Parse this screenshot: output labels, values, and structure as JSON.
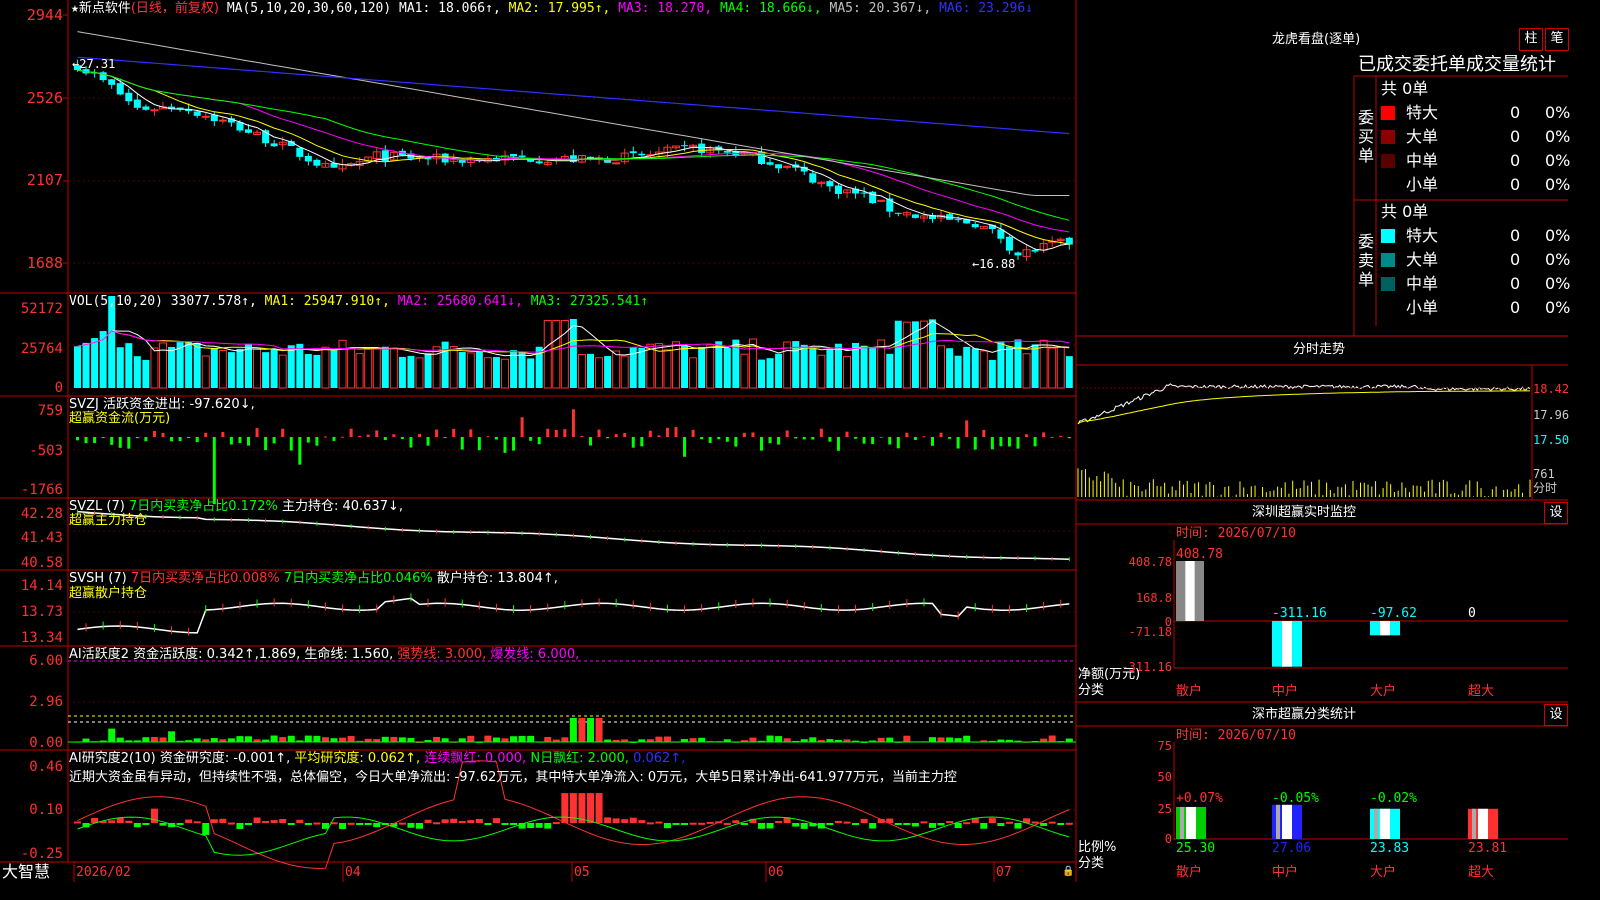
{
  "colors": {
    "up": "#ff3232",
    "down": "#00ffff",
    "ma1": "#ffffff",
    "ma2": "#ffff00",
    "ma3": "#ff00ff",
    "ma4": "#00ff00",
    "ma5": "#c0c0c0",
    "ma6": "#3030ff",
    "grid": "#c00000",
    "green": "#00ff00",
    "yellow": "#ffff00",
    "magenta": "#ff00ff"
  },
  "price_panel": {
    "star_icon": "star-icon",
    "stock_name": "新点软件",
    "period": "(日线，前复权)",
    "ma_label": "MA(5,10,20,30,60,120)",
    "ma1": "MA1: 18.066↑,",
    "ma2": "MA2: 17.995↑,",
    "ma3": "MA3: 18.270,",
    "ma4": "MA4: 18.666↓,",
    "ma5": "MA5: 20.367↓,",
    "ma6": "MA6: 23.296↓",
    "ticks": [
      "2944",
      "2526",
      "2107",
      "1688"
    ],
    "high_label": "←27.31",
    "low_label": "←16.88"
  },
  "vol_panel": {
    "label": "VOL(5,10,20)",
    "value": "33077.578↑,",
    "ma1": "MA1: 25947.910↑,",
    "ma2": "MA2: 25680.641↓,",
    "ma3": "MA3: 27325.541↑",
    "ticks": [
      "52172",
      "25764",
      "0"
    ]
  },
  "svzj_panel": {
    "label": "SVZJ  活跃资金进出: -97.620↓,",
    "sub": "超赢资金流(万元)",
    "ticks": [
      "759",
      "-503",
      "-1766"
    ]
  },
  "svzl_panel": {
    "label": "SVZL (7)",
    "g1": "7日内买卖净占比0.172%",
    "g2": "主力持仓: 40.637↓,",
    "sub": "超赢主力持仓",
    "ticks": [
      "42.28",
      "41.43",
      "40.58"
    ]
  },
  "svsh_panel": {
    "label": "SVSH (7)",
    "r1": "7日内买卖净占比0.008%",
    "g1": "7日内买卖净占比0.046%",
    "w1": "散户持仓: 13.804↑,",
    "sub": "超赢散户持仓",
    "ticks": [
      "14.14",
      "13.73",
      "13.34"
    ]
  },
  "ai_active": {
    "label": "AI活跃度2",
    "w1": "资金活跃度: 0.342↑,1.869,",
    "w2": "生命线: 1.560,",
    "r1": "强势线: 3.000,",
    "m1": "爆发线: 6.000,",
    "ticks": [
      "6.00",
      "2.96",
      "0.00"
    ]
  },
  "ai_research": {
    "label": "AI研究度2(10)",
    "w1": "资金研究度: -0.001↑,",
    "y1": "平均研究度: 0.062↑,",
    "m1": "连续飘红: 0.000,",
    "g1": "N日飘红: 2.000,",
    "b1": "0.062↑,",
    "comment": "近期大资金虽有异动，但持续性不强，总体偏空，今日大单净流出: -97.62万元，其中特大单净流入: 0万元，大单5日累计净出-641.977万元，当前主力控",
    "ticks": [
      "0.46",
      "0.10",
      "-0.25"
    ]
  },
  "date_axis": {
    "brand": "大智慧",
    "dates": [
      "2026/02",
      "04",
      "05",
      "06",
      "07"
    ]
  },
  "right": {
    "lhkp_title": "龙虎看盘(逐单)",
    "btn_zhu": "柱",
    "btn_bi": "笔",
    "stats_title": "已成交委托单成交量统计",
    "buy_label": "委买单",
    "sell_label": "委卖单",
    "buy_total": "共 0单",
    "sell_total": "共 0单",
    "buy_rows": [
      {
        "name": "特大",
        "v": "0",
        "p": "0%"
      },
      {
        "name": "大单",
        "v": "0",
        "p": "0%"
      },
      {
        "name": "中单",
        "v": "0",
        "p": "0%"
      },
      {
        "name": "小单",
        "v": "0",
        "p": "0%"
      }
    ],
    "sell_rows": [
      {
        "name": "特大",
        "v": "0",
        "p": "0%"
      },
      {
        "name": "大单",
        "v": "0",
        "p": "0%"
      },
      {
        "name": "中单",
        "v": "0",
        "p": "0%"
      },
      {
        "name": "小单",
        "v": "0",
        "p": "0%"
      }
    ],
    "buy_colors": [
      "#ff0000",
      "#8b0000",
      "#5a0000",
      "#000000"
    ],
    "sell_colors": [
      "#00ffff",
      "#008b8b",
      "#006060",
      "#000000"
    ],
    "intraday_title": "分时走势",
    "intraday_ticks": [
      "18.42",
      "17.96",
      "17.50",
      "761",
      "分时"
    ],
    "monitor_title": "深圳超赢实时监控",
    "monitor_btn": "设",
    "monitor_time": "时间: 2026/07/10",
    "monitor_ticks": [
      "408.78",
      "168.8",
      "0",
      "-71.18",
      "-311.16"
    ],
    "monitor_ylabel": "净额(万元)",
    "monitor_xlabel": "分类",
    "monitor_cats": [
      "散户",
      "中户",
      "大户",
      "超大"
    ],
    "monitor_values": [
      408.78,
      -311.16,
      -97.62,
      0
    ],
    "monitor_value_labels": [
      "408.78",
      "-311.16",
      "-97.62",
      "0"
    ],
    "class_title": "深市超赢分类统计",
    "class_btn": "设",
    "class_time": "时间: 2026/07/10",
    "class_ticks": [
      "75",
      "50",
      "25",
      "0"
    ],
    "class_ylabel": "比例%",
    "class_xlabel": "分类",
    "class_cats": [
      "散户",
      "中户",
      "大户",
      "超大"
    ],
    "class_pct_labels": [
      "+0.07%",
      "-0.05%",
      "-0.02%",
      ""
    ],
    "class_values": [
      25.3,
      27.06,
      23.83,
      23.81
    ],
    "class_value_labels": [
      "25.30",
      "27.06",
      "23.83",
      "23.81"
    ]
  }
}
